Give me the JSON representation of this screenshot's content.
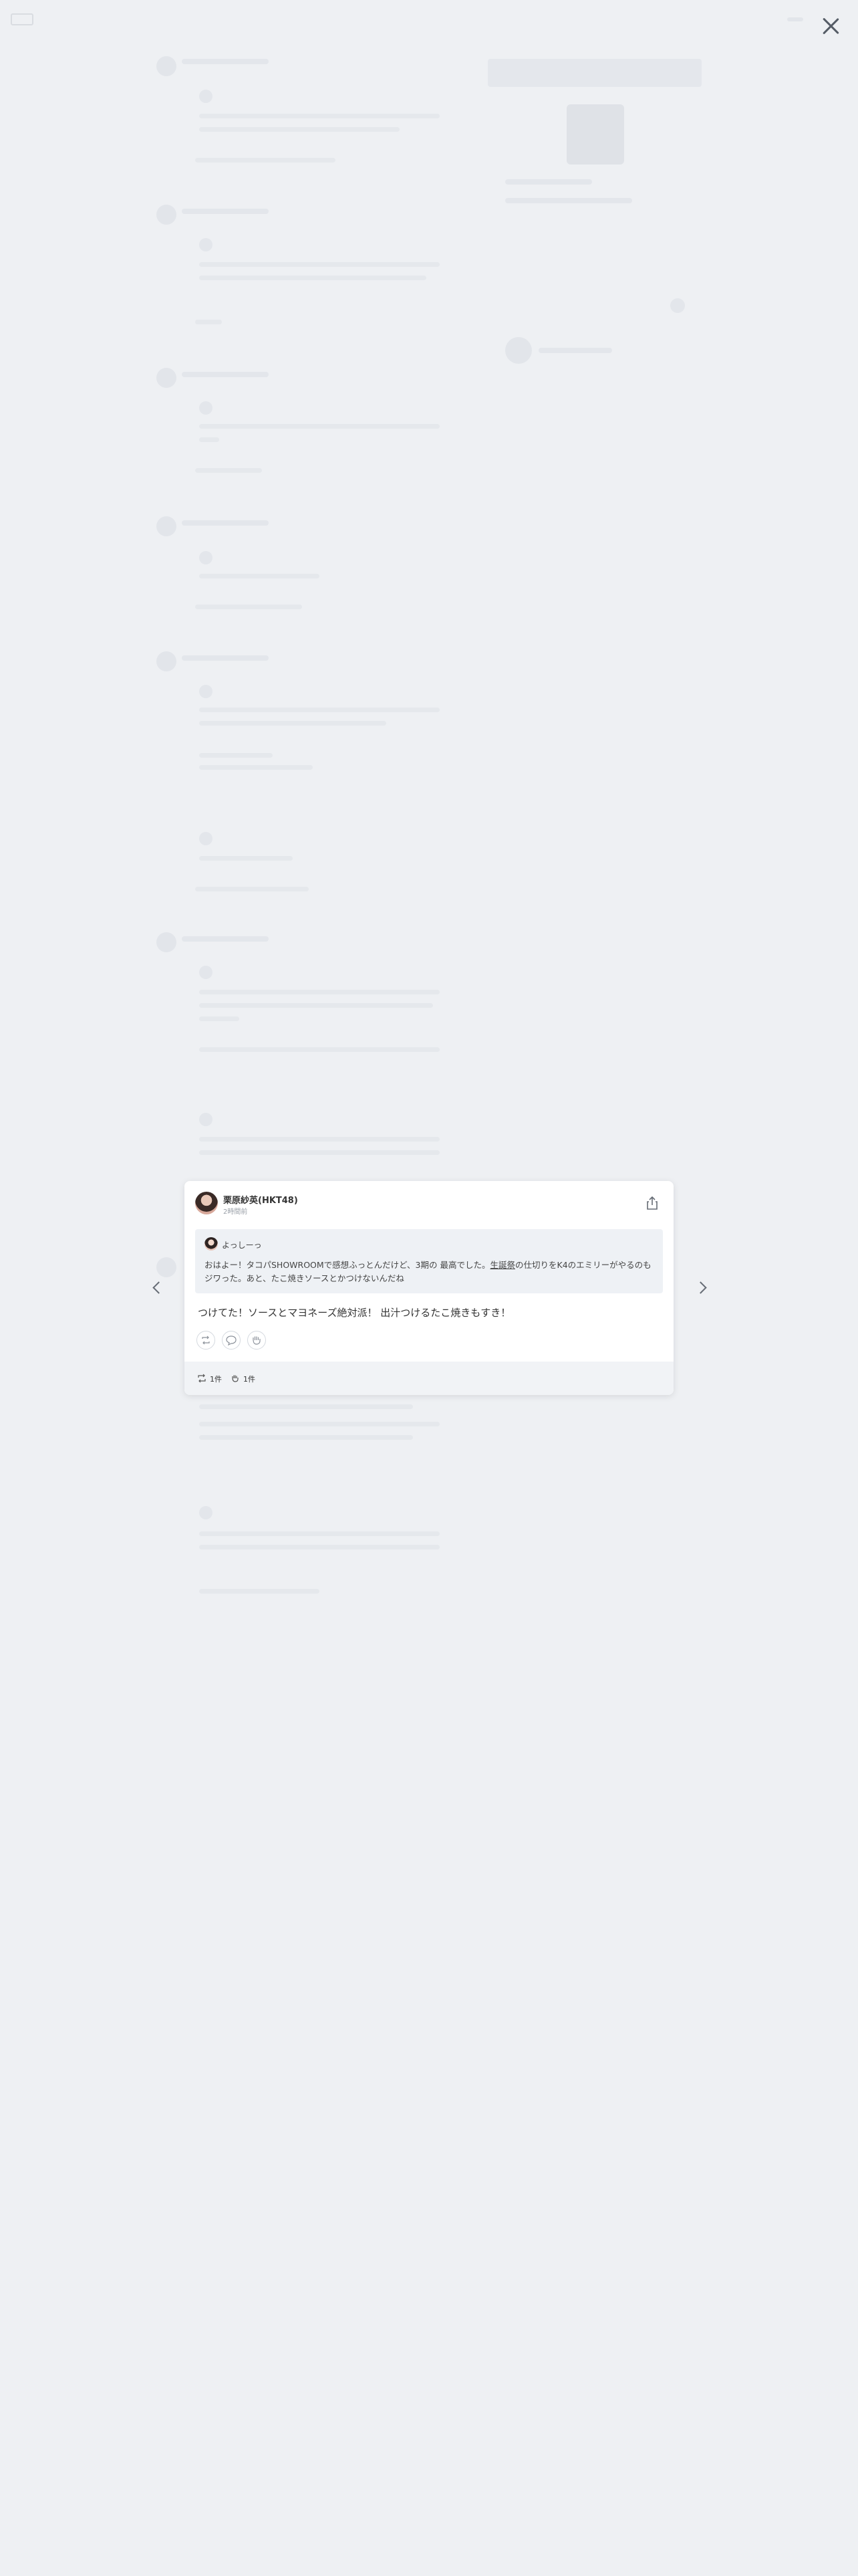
{
  "post": {
    "author_name": "栗原紗英(HKT48)",
    "time_ago": "2時間前",
    "quote": {
      "author_name": "よっしーっ",
      "text_before": "おはよー！タコパSHOWROOMで感想ふっとんだけど、3期の 最高でした。",
      "text_underlined": "生誕祭",
      "text_after": "の仕切りをK4のエミリーがやるのもジワった。あと、たこ焼きソースとかつけないんだね"
    },
    "reply_text": "つけてた！ソースとマヨネーズ絶対派！ 出汁つけるたこ焼きもすき！",
    "stats": {
      "retweet_count": "1件",
      "like_count": "1件"
    }
  },
  "icons": {
    "close": "close-icon",
    "prev": "chevron-left-icon",
    "next": "chevron-right-icon",
    "share": "share-icon",
    "repost": "repost-icon",
    "comment": "speech-bubble-icon",
    "applause": "clap-icon"
  },
  "colors": {
    "page_background": "#eceef1",
    "quote_background": "#eef1f5",
    "footer_background": "#f1f3f6",
    "text": "#333333"
  }
}
